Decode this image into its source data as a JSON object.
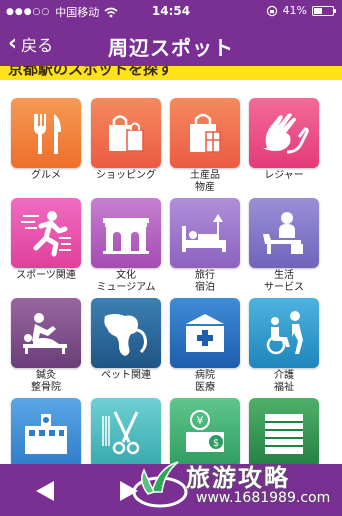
{
  "status": {
    "signal_dots": "●●●○○",
    "carrier": "中国移动",
    "time": "14:54",
    "battery": "41%",
    "battery_level": 0.41
  },
  "nav": {
    "back_label": "戻る",
    "title": "周辺スポット"
  },
  "banner": {
    "text": "京都駅のスポットを探す"
  },
  "categories": [
    {
      "label": "グルメ",
      "icon": "fork-knife-icon",
      "color": "#f07a35"
    },
    {
      "label": "ショッピング",
      "icon": "shopping-bag-icon",
      "color": "#ef6a55"
    },
    {
      "label": "土産品\n物産",
      "icon": "gift-bag-icon",
      "color": "#ef6a55"
    },
    {
      "label": "レジャー",
      "icon": "clapping-hands-icon",
      "color": "#e9488a"
    },
    {
      "label": "スポーツ関連",
      "icon": "runner-icon",
      "color": "#e54da7"
    },
    {
      "label": "文化\nミュージアム",
      "icon": "museum-icon",
      "color": "#b565c1"
    },
    {
      "label": "旅行\n宿泊",
      "icon": "bed-icon",
      "color": "#9c74c9"
    },
    {
      "label": "生活\nサービス",
      "icon": "reception-icon",
      "color": "#8478c8"
    },
    {
      "label": "鍼灸\n整骨院",
      "icon": "massage-icon",
      "color": "#7c4a8a"
    },
    {
      "label": "ペット関連",
      "icon": "dog-icon",
      "color": "#2c6a9c"
    },
    {
      "label": "病院\n医療",
      "icon": "hospital-icon",
      "color": "#2a72c2"
    },
    {
      "label": "介護\n福祉",
      "icon": "wheelchair-icon",
      "color": "#2f9bd0"
    },
    {
      "label": "",
      "icon": "school-icon",
      "color": "#3f90d6"
    },
    {
      "label": "",
      "icon": "scissors-icon",
      "color": "#38b2b8"
    },
    {
      "label": "",
      "icon": "money-icon",
      "color": "#3cb071"
    },
    {
      "label": "",
      "icon": "building-icon",
      "color": "#2e9a54"
    }
  ],
  "watermark": {
    "title": "旅游攻略",
    "url": "www.1681989.com"
  }
}
